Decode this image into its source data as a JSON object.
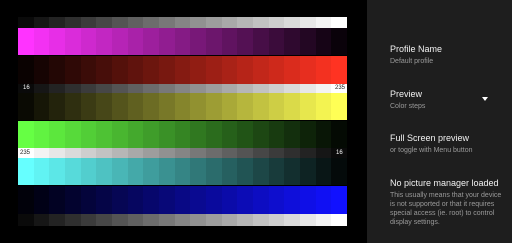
{
  "preview": {
    "gradient_steps": 21,
    "bands": [
      {
        "id": "white-top",
        "color": "#ffffff"
      },
      {
        "id": "magenta",
        "color": "#ff33ff"
      },
      {
        "id": "red",
        "color": "#ff3322"
      },
      {
        "id": "gray-left",
        "color": "#ffffff"
      },
      {
        "id": "yellow",
        "color": "#ffff55"
      },
      {
        "id": "green",
        "color": "#66ff44"
      },
      {
        "id": "gray-right",
        "color": "#ffffff"
      },
      {
        "id": "cyan",
        "color": "#66ffff"
      },
      {
        "id": "blue",
        "color": "#1111ff"
      },
      {
        "id": "white-bottom",
        "color": "#ffffff"
      }
    ],
    "markers": {
      "top_left": "16",
      "top_right": "235",
      "bottom_left": "235",
      "bottom_right": "16"
    }
  },
  "sidebar": {
    "items": [
      {
        "title": "Profile Name",
        "subtitle": "Default profile"
      },
      {
        "title": "Preview",
        "subtitle": "Color steps",
        "icon": "dropdown-arrow-icon"
      },
      {
        "title": "Full Screen preview",
        "subtitle": "or toggle with Menu button"
      },
      {
        "title": "No picture manager loaded",
        "subtitle": "This usually means that your device is not supported or that it requires special access (ie. root) to control display settings."
      }
    ]
  }
}
